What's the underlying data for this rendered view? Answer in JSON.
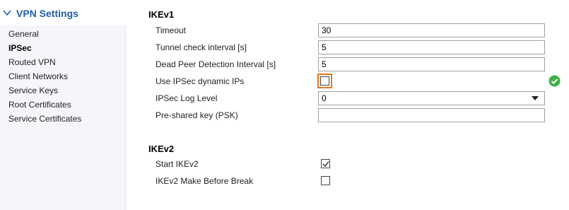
{
  "sidebar": {
    "title": "VPN Settings",
    "items": [
      {
        "label": "General",
        "active": false
      },
      {
        "label": "IPSec",
        "active": true
      },
      {
        "label": "Routed VPN",
        "active": false
      },
      {
        "label": "Client Networks",
        "active": false
      },
      {
        "label": "Service Keys",
        "active": false
      },
      {
        "label": "Root Certificates",
        "active": false
      },
      {
        "label": "Service Certificates",
        "active": false
      }
    ]
  },
  "ikev1": {
    "title": "IKEv1",
    "timeout": {
      "label": "Timeout",
      "value": "30"
    },
    "tunnel_check": {
      "label": "Tunnel check interval [s]",
      "value": "5"
    },
    "dpd": {
      "label": "Dead Peer Detection Interval [s]",
      "value": "5"
    },
    "dynamic_ips": {
      "label": "Use IPSec dynamic IPs",
      "checked": false
    },
    "log_level": {
      "label": "IPSec Log Level",
      "value": "0"
    },
    "psk": {
      "label": "Pre-shared key (PSK)",
      "value": ""
    }
  },
  "ikev2": {
    "title": "IKEv2",
    "start": {
      "label": "Start IKEv2",
      "checked": true
    },
    "make_before_break": {
      "label": "IKEv2 Make Before Break",
      "checked": false
    }
  },
  "colors": {
    "accent": "#1f5ea8",
    "focus": "#e8761b",
    "success": "#3cb043"
  }
}
